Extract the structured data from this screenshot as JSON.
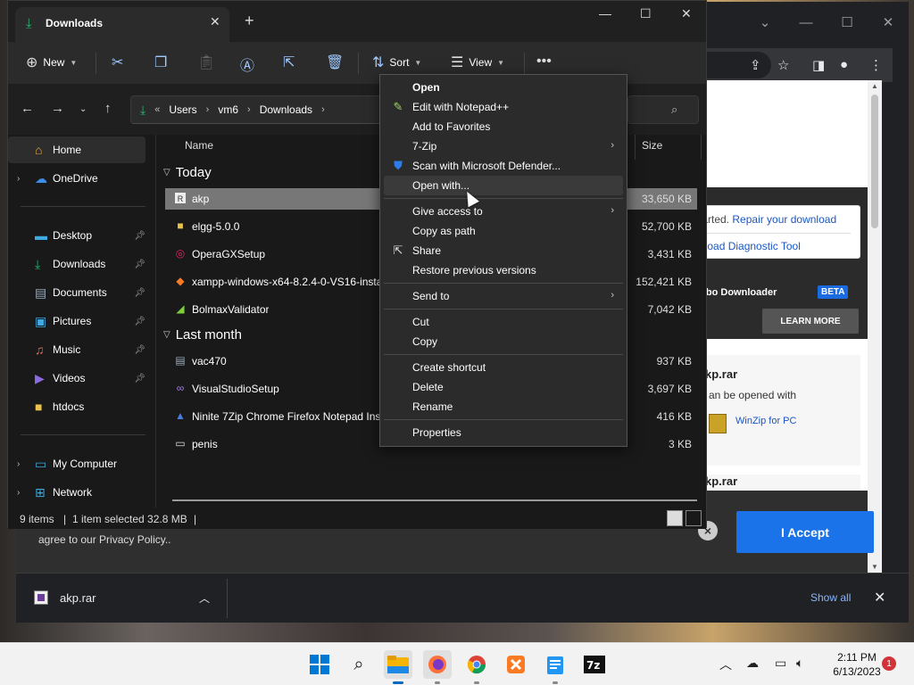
{
  "colors": {
    "accent": "#28b36b",
    "selection": "#777777",
    "menu_bg": "#2b2b2b",
    "accept_blue": "#1a73e8"
  },
  "explorer": {
    "tab_title": "Downloads",
    "toolbar": {
      "new": "New",
      "sort": "Sort",
      "view": "View"
    },
    "breadcrumb": [
      "Users",
      "vm6",
      "Downloads"
    ],
    "nav": {
      "home": "Home",
      "onedrive": "OneDrive",
      "desktop": "Desktop",
      "downloads": "Downloads",
      "documents": "Documents",
      "pictures": "Pictures",
      "music": "Music",
      "videos": "Videos",
      "htdocs": "htdocs",
      "my_computer": "My Computer",
      "network": "Network"
    },
    "columns": {
      "name": "Name",
      "size": "Size"
    },
    "groups": {
      "today": "Today",
      "last_month": "Last month"
    },
    "today_files": [
      {
        "name": "akp",
        "size": "33,650 KB"
      },
      {
        "name": "elgg-5.0.0",
        "size": "52,700 KB"
      },
      {
        "name": "OperaGXSetup",
        "size": "3,431 KB"
      },
      {
        "name": "xampp-windows-x64-8.2.4-0-VS16-instal...",
        "size": "152,421 KB"
      },
      {
        "name": "BolmaxValidator",
        "size": "7,042 KB"
      }
    ],
    "month_files": [
      {
        "name": "vac470",
        "size": "937 KB"
      },
      {
        "name": "VisualStudioSetup",
        "size": "3,697 KB"
      },
      {
        "name": "Ninite 7Zip Chrome Firefox Notepad Inst...",
        "size": "416 KB"
      },
      {
        "name": "penis",
        "size": "3 KB"
      }
    ],
    "status": {
      "items": "9 items",
      "selected": "1 item selected  32.8 MB"
    }
  },
  "context_menu": {
    "open": "Open",
    "notepad": "Edit with Notepad++",
    "favorites": "Add to Favorites",
    "zip": "7-Zip",
    "defender": "Scan with Microsoft Defender...",
    "open_with": "Open with...",
    "give_access": "Give access to",
    "copy_path": "Copy as path",
    "share": "Share",
    "restore": "Restore previous versions",
    "send_to": "Send to",
    "cut": "Cut",
    "copy": "Copy",
    "create_shortcut": "Create shortcut",
    "delete": "Delete",
    "rename": "Rename",
    "properties": "Properties"
  },
  "browser": {
    "line1_a": "tarted.",
    "line1_b": "Repair your download",
    "line2": "nload Diagnostic Tool",
    "turbo": "Turbo Downloader",
    "beta": "BETA",
    "card_e": "e.",
    "learn_more": "LEARN MORE",
    "rar_title": "kp.rar",
    "rar_sub": "an be opened with",
    "winzip": "WinZip for PC",
    "rar2": "kp.rar",
    "cookie_text": "agree to our Privacy Policy..",
    "accept": "I Accept",
    "download_name": "akp.rar",
    "show_all": "Show all"
  },
  "taskbar": {
    "time": "2:11 PM",
    "date": "6/13/2023",
    "notifications": "1"
  }
}
